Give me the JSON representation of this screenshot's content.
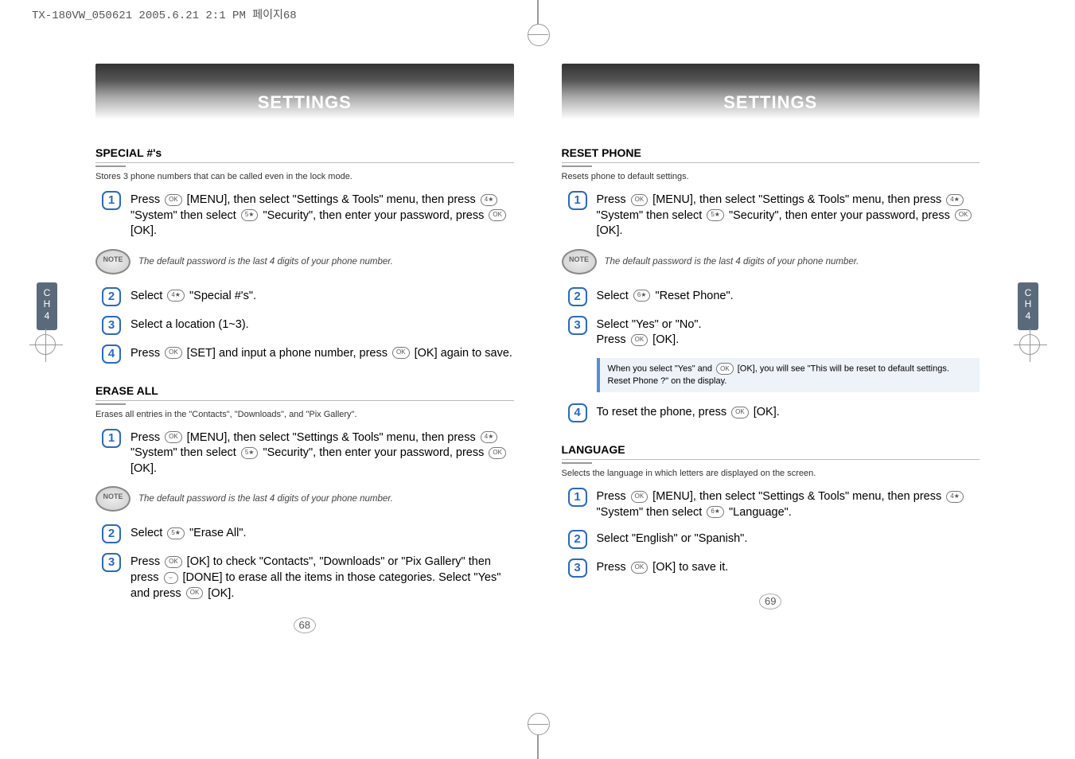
{
  "print_header": "TX-180VW_050621  2005.6.21 2:1 PM  페이지68",
  "header_label": "SETTINGS",
  "side_tab": "C\nH\n4",
  "note_badge": "NOTE",
  "keys": {
    "ok": "OK",
    "k4": "4★",
    "k5": "5★",
    "k6": "6★",
    "done": "⌣"
  },
  "note_password": "The default password is the last 4 digits of your phone number.",
  "left": {
    "special": {
      "title": "SPECIAL #'s",
      "subtitle": "Stores 3 phone numbers that can be called even in the lock mode.",
      "step1a": "Press ",
      "step1b": " [MENU], then select \"Settings & Tools\" menu, then press ",
      "step1c": " \"System\" then select ",
      "step1d": " \"Security\", then enter your password, press ",
      "step1e": " [OK].",
      "step2a": "Select ",
      "step2b": " \"Special #'s\".",
      "step3": "Select a location (1~3).",
      "step4a": "Press ",
      "step4b": " [SET] and input a phone number, press ",
      "step4c": " [OK] again to save."
    },
    "erase": {
      "title": "ERASE ALL",
      "subtitle": "Erases all entries in the \"Contacts\", \"Downloads\", and \"Pix Gallery\".",
      "step1a": "Press ",
      "step1b": " [MENU], then select \"Settings & Tools\" menu, then press ",
      "step1c": " \"System\" then select ",
      "step1d": " \"Security\", then enter your password, press ",
      "step1e": " [OK].",
      "step2a": "Select ",
      "step2b": " \"Erase All\".",
      "step3a": "Press ",
      "step3b": " [OK] to check \"Contacts\", \"Downloads\" or \"Pix Gallery\" then press ",
      "step3c": " [DONE] to erase all the items in those categories. Select \"Yes\" and press ",
      "step3d": " [OK]."
    },
    "page_num": "68"
  },
  "right": {
    "reset": {
      "title": "RESET PHONE",
      "subtitle": "Resets phone to default settings.",
      "step1a": "Press ",
      "step1b": " [MENU], then select \"Settings & Tools\" menu, then press ",
      "step1c": " \"System\" then select ",
      "step1d": " \"Security\", then enter your password, press ",
      "step1e": " [OK].",
      "step2a": "Select ",
      "step2b": " \"Reset Phone\".",
      "step3a": "Select \"Yes\" or \"No\".",
      "step3b": "Press ",
      "step3c": " [OK].",
      "callout_a": "When you select \"Yes\" and ",
      "callout_b": " [OK], you will see \"This will be reset to default settings. Reset Phone ?\" on the display.",
      "step4a": "To reset the phone, press ",
      "step4b": " [OK]."
    },
    "language": {
      "title": "LANGUAGE",
      "subtitle": "Selects the language in which letters are displayed on the screen.",
      "step1a": "Press ",
      "step1b": " [MENU], then select \"Settings & Tools\" menu, then press ",
      "step1c": " \"System\" then select ",
      "step1d": " \"Language\".",
      "step2": "Select \"English\" or \"Spanish\".",
      "step3a": "Press ",
      "step3b": " [OK] to save it."
    },
    "page_num": "69"
  }
}
